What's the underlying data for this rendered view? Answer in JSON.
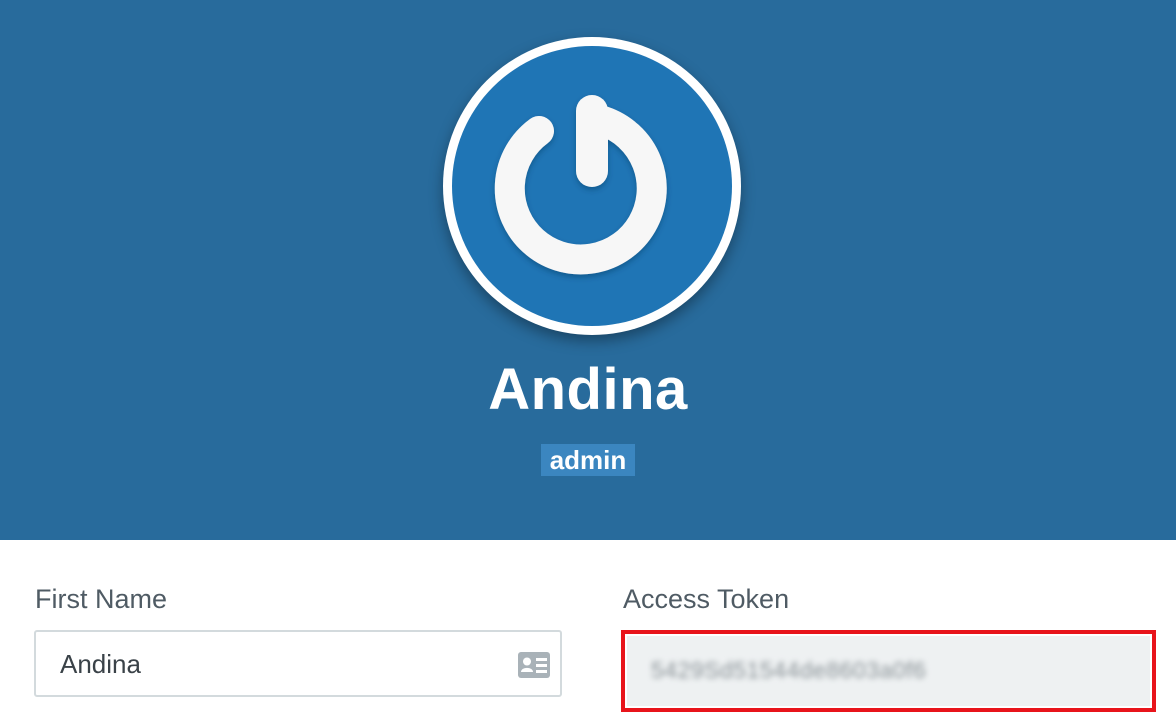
{
  "profile": {
    "display_name": "Andina",
    "role": "admin",
    "avatar_icon": "power-icon",
    "header_color": "#286b9c",
    "avatar_color": "#1f75b5"
  },
  "form": {
    "first_name": {
      "label": "First Name",
      "value": "Andina",
      "icon": "contact-card-icon"
    },
    "access_token": {
      "label": "Access Token",
      "value": "5429Sd51544de8603a0f6",
      "highlight_color": "#e8141b"
    }
  }
}
